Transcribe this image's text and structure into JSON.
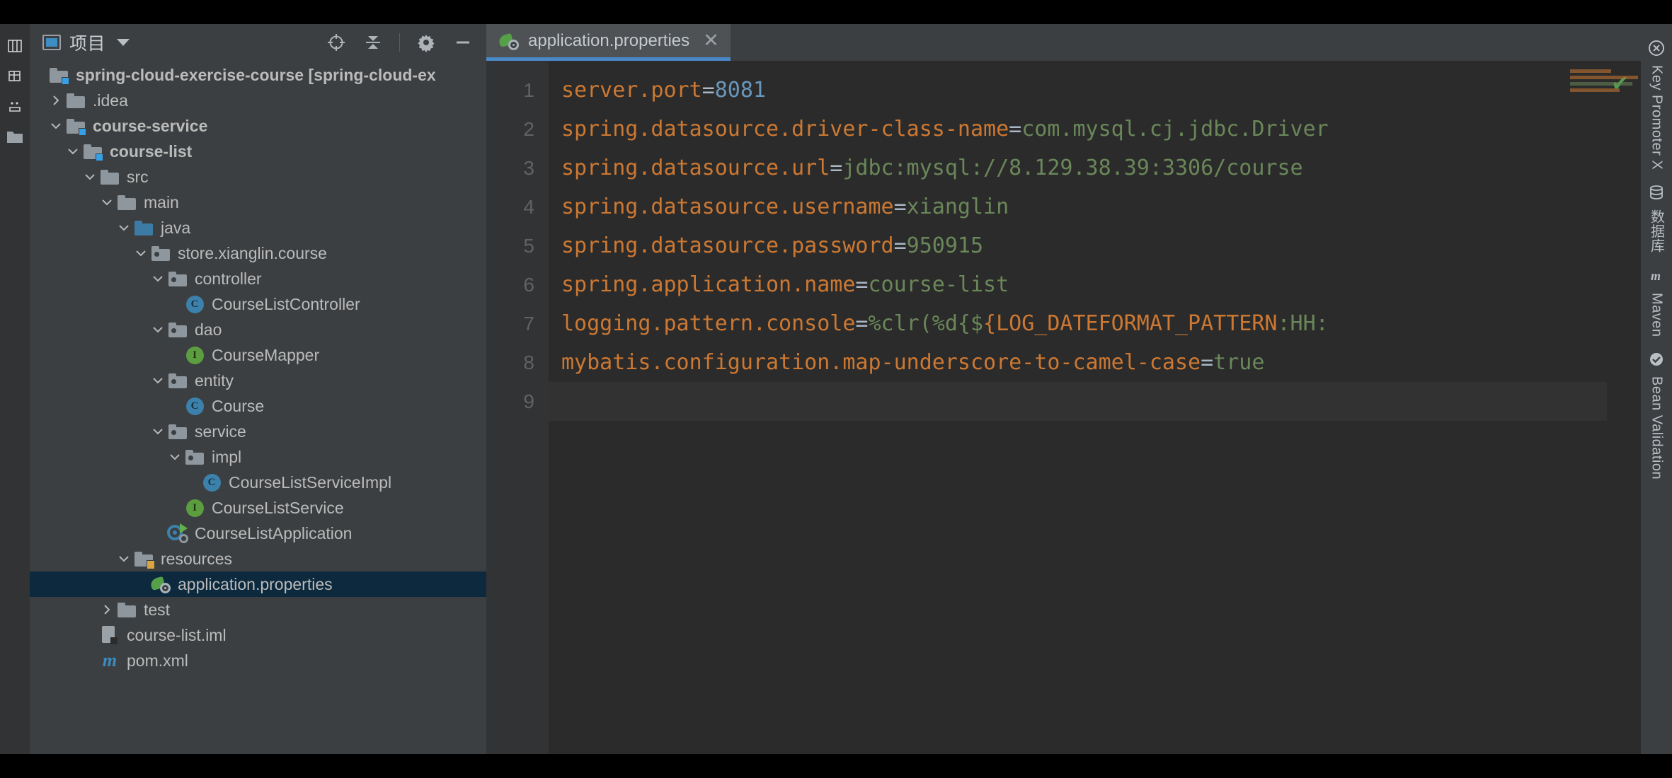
{
  "window": {
    "theme_bg": "#3c3f41",
    "editor_bg": "#2b2b2b",
    "accent": "#4a88c7",
    "selection_bg": "#0d293e"
  },
  "left_rail": {
    "items": [
      {
        "name": "structure-icon",
        "label": "结构"
      },
      {
        "name": "favorites-icon",
        "label": "收藏夹"
      },
      {
        "name": "commit-icon",
        "label": "提交"
      },
      {
        "name": "project-files-icon",
        "label": "项目文件"
      }
    ]
  },
  "project_panel": {
    "title": "项目",
    "dropdown_caret": "▾",
    "tools": [
      {
        "name": "select-opened-file-button",
        "label": "选择打开的文件"
      },
      {
        "name": "collapse-all-button",
        "label": "全部折叠"
      },
      {
        "name": "settings-button",
        "label": "设置"
      },
      {
        "name": "hide-button",
        "label": "隐藏"
      }
    ],
    "tree": [
      {
        "depth": 0,
        "twisty": "none",
        "icon": "module-folder",
        "label": "spring-cloud-exercise-course [spring-cloud-ex",
        "bold": true,
        "selected": false
      },
      {
        "depth": 1,
        "twisty": "collapsed",
        "icon": "folder",
        "label": ".idea",
        "bold": false,
        "selected": false
      },
      {
        "depth": 1,
        "twisty": "expanded",
        "icon": "module-folder",
        "label": "course-service",
        "bold": true,
        "selected": false
      },
      {
        "depth": 2,
        "twisty": "expanded",
        "icon": "module-folder",
        "label": "course-list",
        "bold": true,
        "selected": false
      },
      {
        "depth": 3,
        "twisty": "expanded",
        "icon": "folder",
        "label": "src",
        "bold": false,
        "selected": false
      },
      {
        "depth": 4,
        "twisty": "expanded",
        "icon": "folder",
        "label": "main",
        "bold": false,
        "selected": false
      },
      {
        "depth": 5,
        "twisty": "expanded",
        "icon": "source-folder",
        "label": "java",
        "bold": false,
        "selected": false
      },
      {
        "depth": 6,
        "twisty": "expanded",
        "icon": "package",
        "label": "store.xianglin.course",
        "bold": false,
        "selected": false
      },
      {
        "depth": 7,
        "twisty": "expanded",
        "icon": "package",
        "label": "controller",
        "bold": false,
        "selected": false
      },
      {
        "depth": 8,
        "twisty": "none",
        "icon": "class",
        "label": "CourseListController",
        "bold": false,
        "selected": false
      },
      {
        "depth": 7,
        "twisty": "expanded",
        "icon": "package",
        "label": "dao",
        "bold": false,
        "selected": false
      },
      {
        "depth": 8,
        "twisty": "none",
        "icon": "interface",
        "label": "CourseMapper",
        "bold": false,
        "selected": false
      },
      {
        "depth": 7,
        "twisty": "expanded",
        "icon": "package",
        "label": "entity",
        "bold": false,
        "selected": false
      },
      {
        "depth": 8,
        "twisty": "none",
        "icon": "class",
        "label": "Course",
        "bold": false,
        "selected": false
      },
      {
        "depth": 7,
        "twisty": "expanded",
        "icon": "package",
        "label": "service",
        "bold": false,
        "selected": false
      },
      {
        "depth": 8,
        "twisty": "expanded",
        "icon": "package",
        "label": "impl",
        "bold": false,
        "selected": false
      },
      {
        "depth": 9,
        "twisty": "none",
        "icon": "class",
        "label": "CourseListServiceImpl",
        "bold": false,
        "selected": false
      },
      {
        "depth": 8,
        "twisty": "none",
        "icon": "interface",
        "label": "CourseListService",
        "bold": false,
        "selected": false
      },
      {
        "depth": 7,
        "twisty": "none",
        "icon": "spring-app",
        "label": "CourseListApplication",
        "bold": false,
        "selected": false
      },
      {
        "depth": 5,
        "twisty": "expanded",
        "icon": "resource-folder",
        "label": "resources",
        "bold": false,
        "selected": false
      },
      {
        "depth": 6,
        "twisty": "none",
        "icon": "spring-config",
        "label": "application.properties",
        "bold": false,
        "selected": true
      },
      {
        "depth": 4,
        "twisty": "collapsed",
        "icon": "folder",
        "label": "test",
        "bold": false,
        "selected": false
      },
      {
        "depth": 3,
        "twisty": "none",
        "icon": "iml-file",
        "label": "course-list.iml",
        "bold": false,
        "selected": false
      },
      {
        "depth": 3,
        "twisty": "none",
        "icon": "maven-pom",
        "label": "pom.xml",
        "bold": false,
        "selected": false
      }
    ]
  },
  "editor": {
    "tabs": [
      {
        "name": "tab-application-properties",
        "label": "application.properties",
        "icon": "spring-config-icon",
        "close": "✕",
        "active": true
      }
    ],
    "gutter_lines": [
      "1",
      "2",
      "3",
      "4",
      "5",
      "6",
      "7",
      "8",
      "9"
    ],
    "inspection_status": "✔",
    "lines": [
      {
        "n": 1,
        "segments": [
          {
            "t": "server.port",
            "c": "k"
          },
          {
            "t": "=",
            "c": "eq"
          },
          {
            "t": "8081",
            "c": "n"
          }
        ]
      },
      {
        "n": 2,
        "segments": [
          {
            "t": "spring.datasource.driver-class-name",
            "c": "k"
          },
          {
            "t": "=",
            "c": "eq"
          },
          {
            "t": "com.mysql.cj.jdbc.Driver",
            "c": "v"
          }
        ]
      },
      {
        "n": 3,
        "segments": [
          {
            "t": "spring.datasource.url",
            "c": "k"
          },
          {
            "t": "=",
            "c": "eq"
          },
          {
            "t": "jdbc:mysql://8.129.38.39:3306/course",
            "c": "v"
          }
        ]
      },
      {
        "n": 4,
        "segments": [
          {
            "t": "spring.datasource.username",
            "c": "k"
          },
          {
            "t": "=",
            "c": "eq"
          },
          {
            "t": "xianglin",
            "c": "v"
          }
        ]
      },
      {
        "n": 5,
        "segments": [
          {
            "t": "spring.datasource.password",
            "c": "k"
          },
          {
            "t": "=",
            "c": "eq"
          },
          {
            "t": "950915",
            "c": "v"
          }
        ]
      },
      {
        "n": 6,
        "segments": [
          {
            "t": "spring.application.name",
            "c": "k"
          },
          {
            "t": "=",
            "c": "eq"
          },
          {
            "t": "course-list",
            "c": "v"
          }
        ]
      },
      {
        "n": 7,
        "segments": [
          {
            "t": "logging.pattern.console",
            "c": "k"
          },
          {
            "t": "=",
            "c": "eq"
          },
          {
            "t": "%clr(%d{$",
            "c": "v"
          },
          {
            "t": "{LOG_DATEFORMAT_PATTERN",
            "c": "ph"
          },
          {
            "t": ":HH:",
            "c": "v"
          }
        ]
      },
      {
        "n": 8,
        "segments": [
          {
            "t": "mybatis.configuration.map-underscore-to-camel-case",
            "c": "k"
          },
          {
            "t": "=",
            "c": "eq"
          },
          {
            "t": "true",
            "c": "v"
          }
        ]
      },
      {
        "n": 9,
        "segments": []
      }
    ]
  },
  "right_rail": {
    "items": [
      {
        "name": "key-promoter-x-tool",
        "label": "Key Promoter X",
        "icon": "key-promoter-icon"
      },
      {
        "name": "database-tool",
        "label": "数据库",
        "icon": "database-icon"
      },
      {
        "name": "maven-tool",
        "label": "Maven",
        "icon": "maven-icon"
      },
      {
        "name": "bean-validation-tool",
        "label": "Bean Validation",
        "icon": "bean-validation-icon"
      }
    ]
  }
}
